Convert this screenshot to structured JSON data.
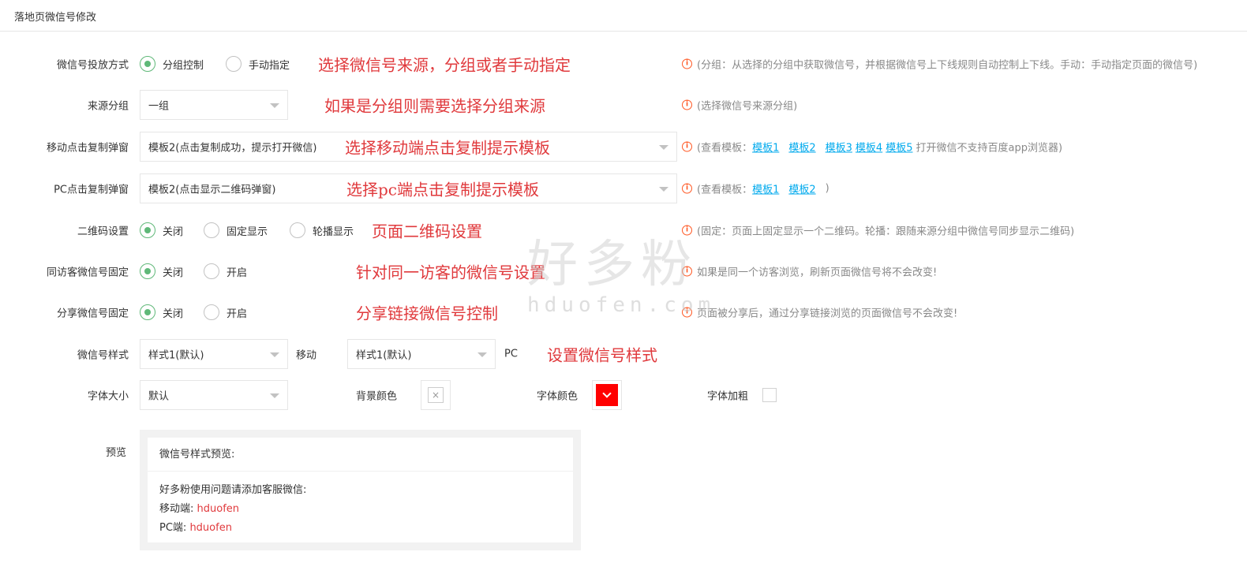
{
  "header": {
    "title": "落地页微信号修改"
  },
  "form": {
    "release_mode": {
      "label": "微信号投放方式",
      "options": [
        "分组控制",
        "手动指定"
      ],
      "selected": "分组控制",
      "annotation": "选择微信号来源，分组或者手动指定",
      "tip": "(分组：从选择的分组中获取微信号，并根据微信号上下线规则自动控制上下线。手动：手动指定页面的微信号)"
    },
    "source_group": {
      "label": "来源分组",
      "value": "一组",
      "annotation": "如果是分组则需要选择分组来源",
      "tip": "(选择微信号来源分组)"
    },
    "mobile_popup": {
      "label": "移动点击复制弹窗",
      "value": "模板2(点击复制成功，提示打开微信)",
      "annotation": "选择移动端点击复制提示模板",
      "tip_prefix": "(查看模板：",
      "links": [
        "模板1",
        "模板2",
        "模板3",
        "模板4",
        "模板5"
      ],
      "tip_suffix": "打开微信不支持百度app浏览器)"
    },
    "pc_popup": {
      "label": "PC点击复制弹窗",
      "value": "模板2(点击显示二维码弹窗)",
      "annotation": "选择pc端点击复制提示模板",
      "tip_prefix": "(查看模板：",
      "links": [
        "模板1",
        "模板2"
      ],
      "tip_suffix": ")"
    },
    "qrcode": {
      "label": "二维码设置",
      "options": [
        "关闭",
        "固定显示",
        "轮播显示"
      ],
      "selected": "关闭",
      "annotation": "页面二维码设置",
      "tip": "(固定：页面上固定显示一个二维码。轮播：跟随来源分组中微信号同步显示二维码)"
    },
    "same_visitor": {
      "label": "同访客微信号固定",
      "options": [
        "关闭",
        "开启"
      ],
      "selected": "关闭",
      "annotation": "针对同一访客的微信号设置",
      "tip": "如果是同一个访客浏览，刷新页面微信号将不会改变!"
    },
    "share_fixed": {
      "label": "分享微信号固定",
      "options": [
        "关闭",
        "开启"
      ],
      "selected": "关闭",
      "annotation": "分享链接微信号控制",
      "tip": "页面被分享后，通过分享链接浏览的页面微信号不会改变!"
    },
    "style": {
      "label": "微信号样式",
      "mobile_value": "样式1(默认)",
      "mobile_label": "移动",
      "pc_value": "样式1(默认)",
      "pc_label": "PC",
      "annotation": "设置微信号样式"
    },
    "font": {
      "size_label": "字体大小",
      "size_value": "默认",
      "bg_color_label": "背景颜色",
      "font_color_label": "字体颜色",
      "font_color": "#ff0000",
      "bold_label": "字体加粗"
    },
    "preview": {
      "label": "预览",
      "head": "微信号样式预览:",
      "line1": "好多粉使用问题请添加客服微信:",
      "mobile_prefix": "移动端:",
      "mobile_value": "hduofen",
      "pc_prefix": "PC端:",
      "pc_value": "hduofen"
    }
  },
  "watermark": {
    "cn": "好多粉",
    "en": "hduofen.com"
  }
}
